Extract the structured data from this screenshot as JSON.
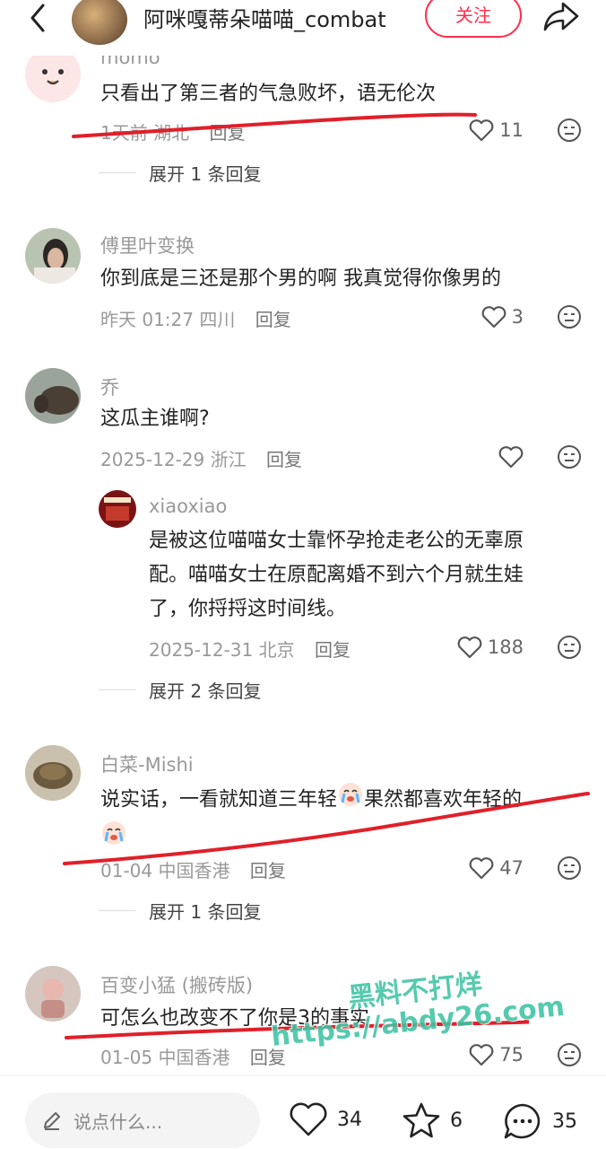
{
  "topbar": {
    "title": "阿咪嘎蒂朵喵喵_combat",
    "follow_label": "关注"
  },
  "comments": [
    {
      "name": "momo",
      "text": "只看出了第三者的气急败坏，语无伦次",
      "time": "1天前",
      "location": "湖北",
      "reply": "回复",
      "likes": "11",
      "expand": "展开 1 条回复"
    },
    {
      "name": "傅里叶变换",
      "text": "你到底是三还是那个男的啊 我真觉得你像男的",
      "time": "昨天 01:27",
      "location": "四川",
      "reply": "回复",
      "likes": "3"
    },
    {
      "name": "乔",
      "text": "这瓜主谁啊?",
      "time": "2025-12-29",
      "location": "浙江",
      "reply": "回复",
      "likes": ""
    },
    {
      "name": "xiaoxiao",
      "text_lines": [
        "是被这位喵喵女士靠怀孕抢走老公的无辜原",
        "配。喵喵女士在原配离婚不到六个月就生娃",
        "了，你捋捋这时间线。"
      ],
      "time": "2025-12-31",
      "location": "北京",
      "reply": "回复",
      "likes": "188",
      "expand": "展开 2 条回复"
    },
    {
      "name": "白菜-Mishi",
      "text_a": "说实话，一看就知道三年轻",
      "text_b": "果然都喜欢年轻的",
      "time": "01-04",
      "location": "中国香港",
      "reply": "回复",
      "likes": "47",
      "expand": "展开 1 条回复"
    },
    {
      "name": "百变小猛 (搬砖版)",
      "text": "可怎么也改变不了你是3的事实",
      "time": "01-05",
      "location": "中国香港",
      "reply": "回复",
      "likes": "75"
    }
  ],
  "bottombar": {
    "placeholder": "说点什么...",
    "likes": "34",
    "stars": "6",
    "comments": "35"
  },
  "watermark": {
    "line1": "黑料不打烊",
    "line2": "https://abdy26.com"
  },
  "colors": {
    "accent": "#ff2e4d",
    "annotation": "#e0202a",
    "watermark": "#3ec3a3"
  }
}
